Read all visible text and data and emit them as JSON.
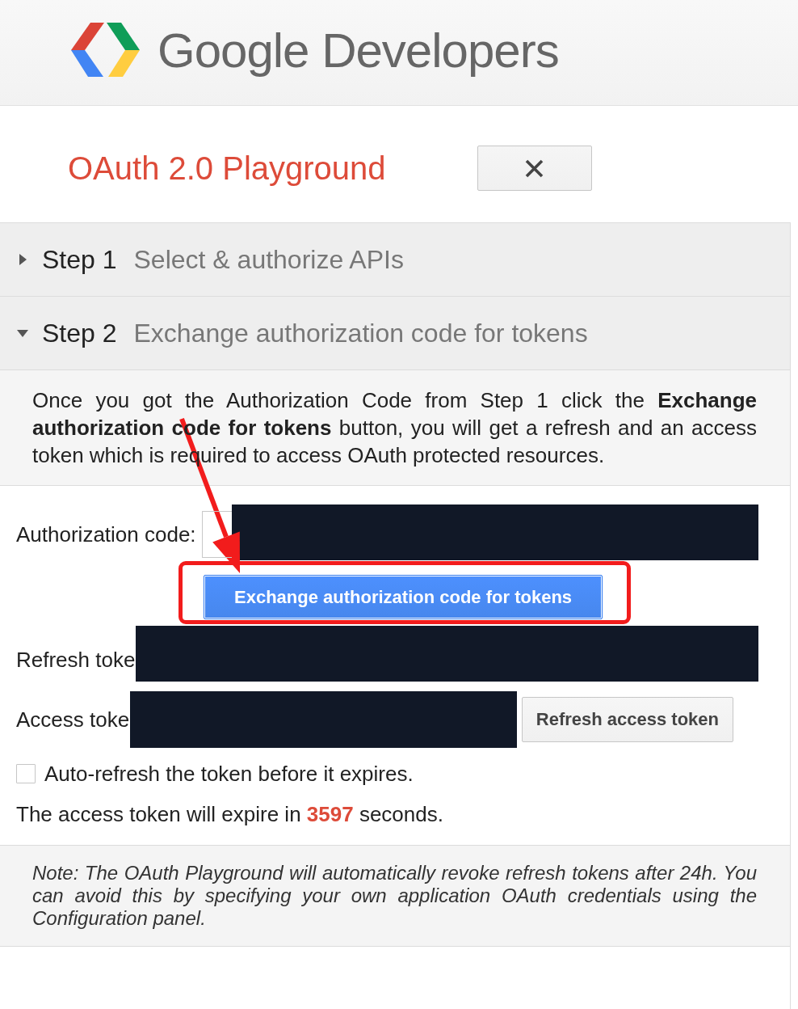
{
  "header": {
    "brand": "Google Developers"
  },
  "title_bar": {
    "title": "OAuth 2.0 Playground"
  },
  "steps": [
    {
      "label": "Step 1",
      "title": "Select & authorize APIs",
      "expanded": false
    },
    {
      "label": "Step 2",
      "title": "Exchange authorization code for tokens",
      "expanded": true,
      "body": {
        "description": "Once you got the Authorization Code from Step 1 click the **Exchange authorization code for tokens** button, you will get a refresh and an access token which is required to access OAuth protected resources.",
        "authorization_code": {
          "label": "Authorization code:",
          "redacted": true
        },
        "exchange_button": {
          "label": "Exchange authorization code for tokens",
          "highlighted": true
        },
        "refresh_token": {
          "label": "Refresh toke",
          "redacted": true
        },
        "access_token": {
          "label": "Access toke",
          "redacted": true
        },
        "refresh_access_token_button": "Refresh access token",
        "auto_refresh": {
          "label": "Auto-refresh the token before it expires.",
          "checked": false
        },
        "expiry": "The access token will expire in **3597** seconds.",
        "note": "Note: The OAuth Playground will automatically revoke refresh tokens after 24h. You can avoid this by specifying your own application OAuth credentials using the Configuration panel."
      }
    }
  ],
  "annotation_arrow": true
}
